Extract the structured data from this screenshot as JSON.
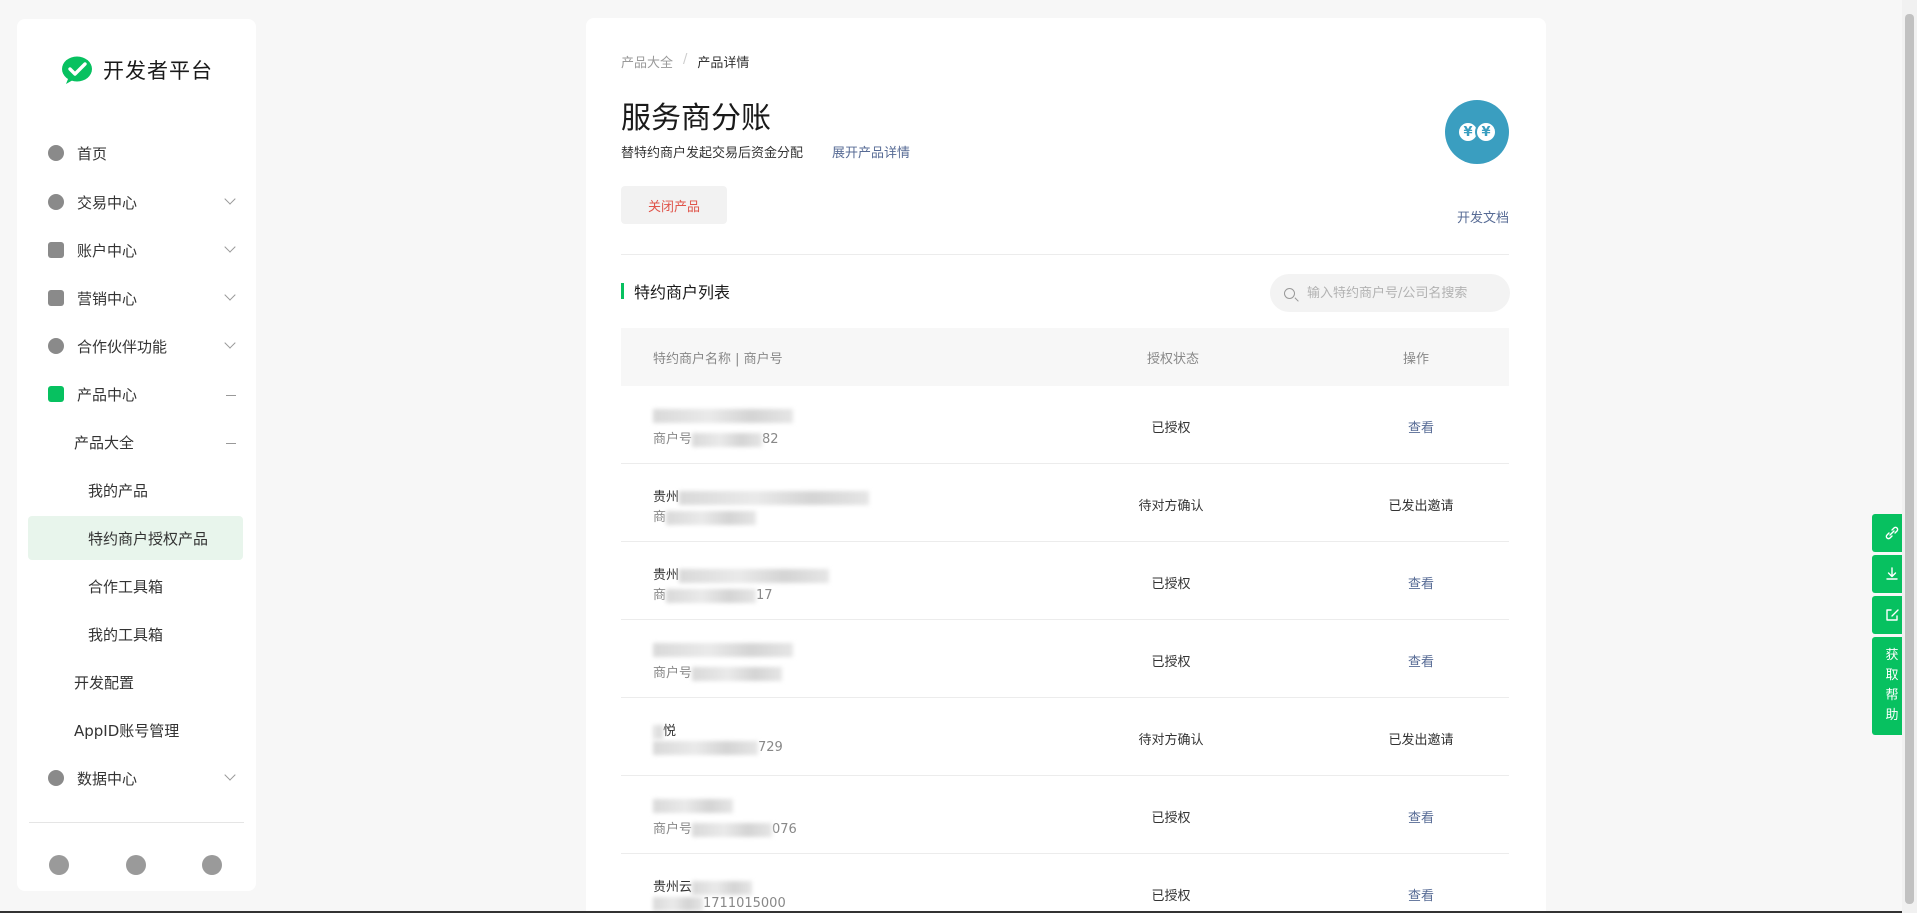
{
  "app": {
    "logo_text": "开发者平台"
  },
  "sidebar": {
    "items": [
      {
        "label": "首页"
      },
      {
        "label": "交易中心"
      },
      {
        "label": "账户中心"
      },
      {
        "label": "营销中心"
      },
      {
        "label": "合作伙伴功能"
      },
      {
        "label": "产品中心"
      },
      {
        "label": "产品大全"
      },
      {
        "label": "我的产品"
      },
      {
        "label": "特约商户授权产品"
      },
      {
        "label": "合作工具箱"
      },
      {
        "label": "我的工具箱"
      },
      {
        "label": "开发配置"
      },
      {
        "label": "AppID账号管理"
      },
      {
        "label": "数据中心"
      }
    ]
  },
  "breadcrumb": {
    "parent": "产品大全",
    "separator": "/",
    "current": "产品详情"
  },
  "product": {
    "title": "服务商分账",
    "description": "替特约商户发起交易后资金分配",
    "expand_label": "展开产品详情",
    "close_label": "关闭产品",
    "doc_label": "开发文档",
    "icon_glyph": "¥"
  },
  "merchants": {
    "section_title": "特约商户列表",
    "search_placeholder": "输入特约商户号/公司名搜索",
    "columns": [
      "特约商户名称 | 商户号",
      "授权状态",
      "操作"
    ],
    "rows": [
      {
        "name": "",
        "mid_prefix": "商户号",
        "mid_suffix": "82",
        "status": "已授权",
        "action": "查看",
        "action_link": true
      },
      {
        "name": "贵州",
        "mid_prefix": "商",
        "mid_suffix": "",
        "status": "待对方确认",
        "action": "已发出邀请",
        "action_link": false
      },
      {
        "name": "贵州",
        "mid_prefix": "商",
        "mid_suffix": "17",
        "status": "已授权",
        "action": "查看",
        "action_link": true
      },
      {
        "name": "",
        "mid_prefix": "商户号",
        "mid_suffix": "",
        "status": "已授权",
        "action": "查看",
        "action_link": true
      },
      {
        "name": "悦",
        "mid_prefix": "",
        "mid_suffix": "729",
        "status": "待对方确认",
        "action": "已发出邀请",
        "action_link": false
      },
      {
        "name": "",
        "mid_prefix": "商户号",
        "mid_suffix": "076",
        "status": "已授权",
        "action": "查看",
        "action_link": true
      },
      {
        "name": "贵州云",
        "mid_prefix": "",
        "mid_suffix": "1711015000",
        "status": "已授权",
        "action": "查看",
        "action_link": true
      }
    ]
  },
  "float_bar": {
    "help_chars": [
      "获",
      "取",
      "帮",
      "助"
    ]
  },
  "colors": {
    "brand_green": "#07c160",
    "link_blue": "#576b95",
    "danger_red": "#e0554b",
    "product_icon_bg": "#3a9ec0"
  }
}
